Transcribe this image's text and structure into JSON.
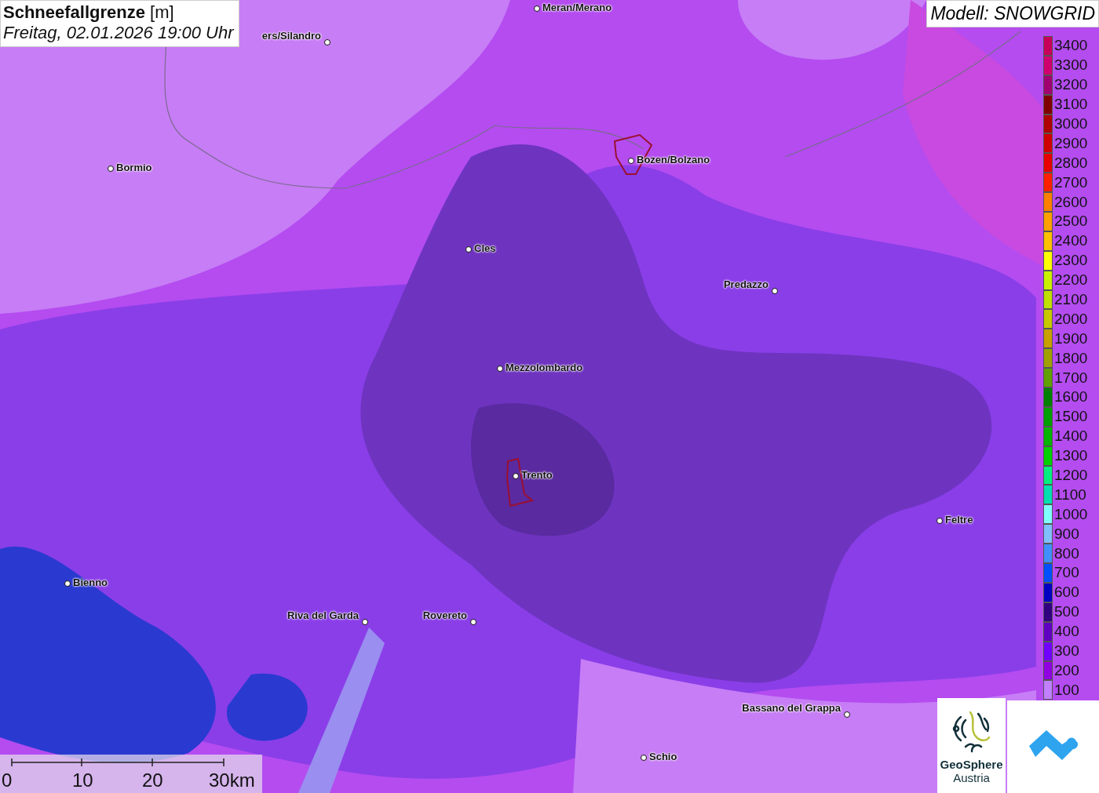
{
  "title": {
    "heading": "Schneefallgrenze",
    "unit": "[m]",
    "datetime": "Freitag, 02.01.2026 19:00 Uhr"
  },
  "model_label": "Modell: SNOWGRID",
  "cities": [
    {
      "name": "Meran/Merano"
    },
    {
      "name": "ers/Silandro"
    },
    {
      "name": "Bormio"
    },
    {
      "name": "Bozen/Bolzano"
    },
    {
      "name": "Cles"
    },
    {
      "name": "Predazzo"
    },
    {
      "name": "Mezzolombardo"
    },
    {
      "name": "Trento"
    },
    {
      "name": "Feltre"
    },
    {
      "name": "Bienno"
    },
    {
      "name": "Riva del Garda"
    },
    {
      "name": "Rovereto"
    },
    {
      "name": "Bassano del Grappa"
    },
    {
      "name": "Schio"
    }
  ],
  "legend": [
    {
      "label": "3400",
      "color": "#c8005a"
    },
    {
      "label": "3300",
      "color": "#d0006e"
    },
    {
      "label": "3200",
      "color": "#a00070"
    },
    {
      "label": "3100",
      "color": "#800000"
    },
    {
      "label": "3000",
      "color": "#b00000"
    },
    {
      "label": "2900",
      "color": "#d00000"
    },
    {
      "label": "2800",
      "color": "#e80000"
    },
    {
      "label": "2700",
      "color": "#ff2000"
    },
    {
      "label": "2600",
      "color": "#ff8000"
    },
    {
      "label": "2500",
      "color": "#ffa000"
    },
    {
      "label": "2400",
      "color": "#ffc000"
    },
    {
      "label": "2300",
      "color": "#ffff00"
    },
    {
      "label": "2200",
      "color": "#c8f000"
    },
    {
      "label": "2100",
      "color": "#c0e000"
    },
    {
      "label": "2000",
      "color": "#c8c800"
    },
    {
      "label": "1900",
      "color": "#c8a000"
    },
    {
      "label": "1800",
      "color": "#a0a000"
    },
    {
      "label": "1700",
      "color": "#60a000"
    },
    {
      "label": "1600",
      "color": "#008000"
    },
    {
      "label": "1500",
      "color": "#00a000"
    },
    {
      "label": "1400",
      "color": "#00b400"
    },
    {
      "label": "1300",
      "color": "#00d000"
    },
    {
      "label": "1200",
      "color": "#00f080"
    },
    {
      "label": "1100",
      "color": "#00e0b0"
    },
    {
      "label": "1000",
      "color": "#80ffff"
    },
    {
      "label": "900",
      "color": "#80c0ff"
    },
    {
      "label": "800",
      "color": "#4090ff"
    },
    {
      "label": "700",
      "color": "#0050ff"
    },
    {
      "label": "600",
      "color": "#0000c0"
    },
    {
      "label": "500",
      "color": "#300080"
    },
    {
      "label": "400",
      "color": "#6000c0"
    },
    {
      "label": "300",
      "color": "#7000ff"
    },
    {
      "label": "200",
      "color": "#9000e0"
    },
    {
      "label": "100",
      "color": "#c080ff"
    }
  ],
  "scale": {
    "ticks": [
      "0",
      "10",
      "20",
      "30km"
    ]
  },
  "logo": {
    "line1": "GeoSphere",
    "line2": "Austria"
  }
}
